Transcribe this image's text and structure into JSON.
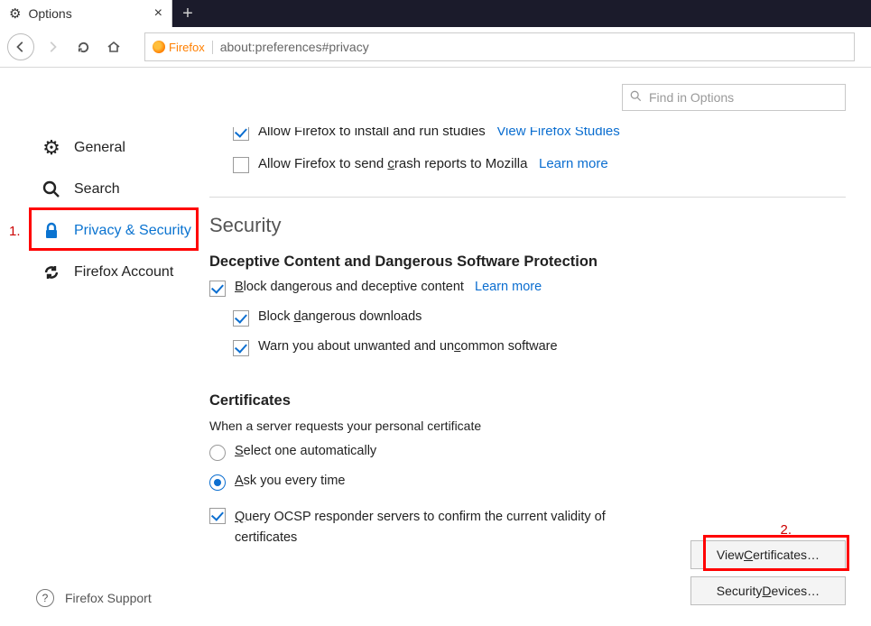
{
  "tab": {
    "title": "Options"
  },
  "urlbar": {
    "identity": "Firefox",
    "url": "about:preferences#privacy"
  },
  "search": {
    "placeholder": "Find in Options"
  },
  "sidebar": {
    "items": [
      {
        "label": "General"
      },
      {
        "label": "Search"
      },
      {
        "label": "Privacy & Security"
      },
      {
        "label": "Firefox Account"
      }
    ],
    "footer": "Firefox Support"
  },
  "partial": {
    "studies_label": "Allow Firefox to install and run studies",
    "studies_link": "View Firefox Studies",
    "crash_label_pre": "Allow Firefox to send ",
    "crash_label_u": "c",
    "crash_label_post": "rash reports to Mozilla",
    "crash_link": "Learn more"
  },
  "security": {
    "title": "Security",
    "deceptive": {
      "title": "Deceptive Content and Dangerous Software Protection",
      "block_u": "B",
      "block_post": "lock dangerous and deceptive content",
      "block_link": "Learn more",
      "downloads_pre": "Block ",
      "downloads_u": "d",
      "downloads_post": "angerous downloads",
      "warn_pre": "Warn you about unwanted and un",
      "warn_u": "c",
      "warn_post": "ommon software"
    },
    "certs": {
      "title": "Certificates",
      "intro": "When a server requests your personal certificate",
      "opt_select_u": "S",
      "opt_select_post": "elect one automatically",
      "opt_ask_u": "A",
      "opt_ask_post": "sk you every time",
      "ocsp_u": "Q",
      "ocsp_post": "uery OCSP responder servers to confirm the current validity of certificates",
      "btn_view_pre": "View ",
      "btn_view_u": "C",
      "btn_view_post": "ertificates…",
      "btn_dev_pre": "Security ",
      "btn_dev_u": "D",
      "btn_dev_post": "evices…"
    }
  },
  "annotations": {
    "one": "1.",
    "two": "2."
  }
}
